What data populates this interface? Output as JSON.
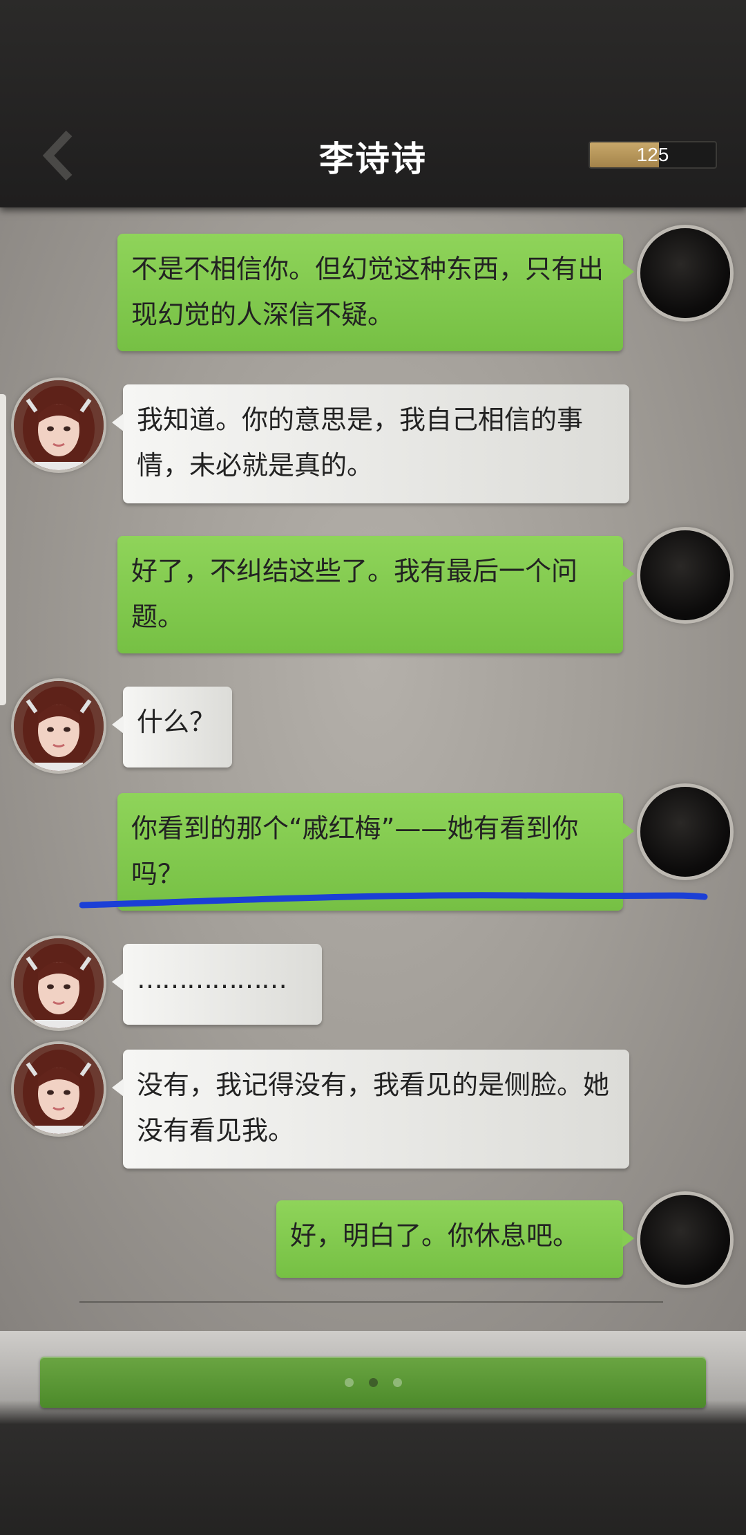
{
  "header": {
    "title": "李诗诗",
    "score": "125",
    "score_fraction": 0.55
  },
  "messages": [
    {
      "sender": "player",
      "text": "不是不相信你。但幻觉这种东西，只有出现幻觉的人深信不疑。"
    },
    {
      "sender": "npc",
      "text": "我知道。你的意思是，我自己相信的事情，未必就是真的。"
    },
    {
      "sender": "player",
      "text": "好了，不纠结这些了。我有最后一个问题。"
    },
    {
      "sender": "npc",
      "text": "什么？"
    },
    {
      "sender": "player",
      "text": "你看到的那个“戚红梅”——她有看到你吗？"
    },
    {
      "sender": "npc",
      "text": "………………"
    },
    {
      "sender": "npc",
      "text": "没有，我记得没有，我看见的是侧脸。她没有看见我。"
    },
    {
      "sender": "player",
      "text": "好，明白了。你休息吧。"
    }
  ],
  "colors": {
    "player_bubble": "#7fc84c",
    "npc_bubble": "#ececea",
    "underline": "#1b3fd6",
    "continue_button": "#5a9836"
  },
  "icons": {
    "back": "chevron-left-icon",
    "player_avatar": "dark-avatar-icon",
    "npc_avatar": "girl-portrait-icon"
  },
  "pager": {
    "count": 3,
    "active": 1
  }
}
